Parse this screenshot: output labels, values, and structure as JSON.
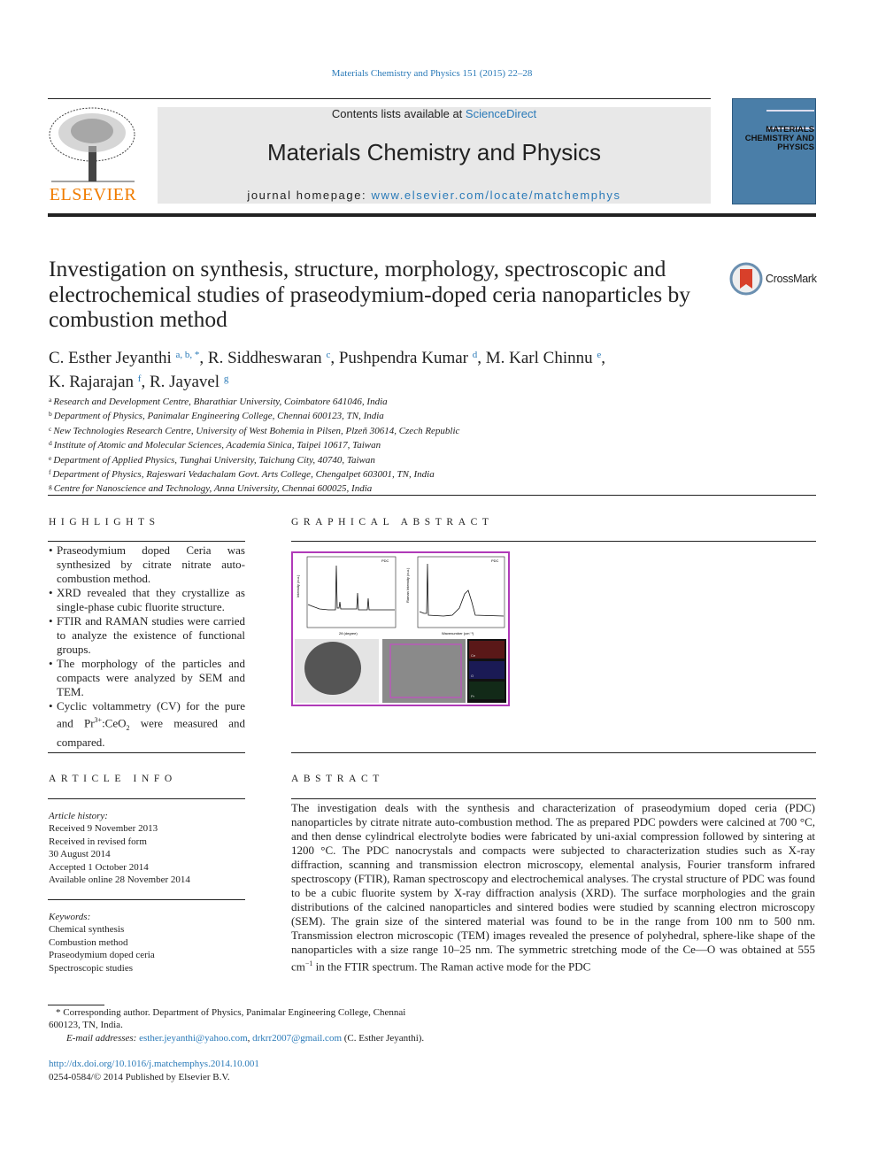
{
  "header": {
    "citation": "Materials Chemistry and Physics 151 (2015) 22–28",
    "contents_prefix": "Contents lists available at ",
    "contents_link": "ScienceDirect",
    "journal_name": "Materials Chemistry and Physics",
    "homepage_prefix": "journal homepage: ",
    "homepage_link": "www.elsevier.com/locate/matchemphys",
    "publisher_logo": "ELSEVIER",
    "cover_title": "MATERIALS CHEMISTRY AND PHYSICS"
  },
  "article": {
    "title": "Investigation on synthesis, structure, morphology, spectroscopic and electrochemical studies of praseodymium-doped ceria nanoparticles by combustion method",
    "crossmark": "CrossMark",
    "authors": [
      {
        "name": "C. Esther Jeyanthi",
        "sup": "a, b, *"
      },
      {
        "name": "R. Siddheswaran",
        "sup": "c"
      },
      {
        "name": "Pushpendra Kumar",
        "sup": "d"
      },
      {
        "name": "M. Karl Chinnu",
        "sup": "e"
      },
      {
        "name": "K. Rajarajan",
        "sup": "f"
      },
      {
        "name": "R. Jayavel",
        "sup": "g"
      }
    ],
    "affiliations": [
      {
        "key": "a",
        "text": "Research and Development Centre, Bharathiar University, Coimbatore 641046, India"
      },
      {
        "key": "b",
        "text": "Department of Physics, Panimalar Engineering College, Chennai 600123, TN, India"
      },
      {
        "key": "c",
        "text": "New Technologies Research Centre, University of West Bohemia in Pilsen, Plzeň 30614, Czech Republic"
      },
      {
        "key": "d",
        "text": "Institute of Atomic and Molecular Sciences, Academia Sinica, Taipei 10617, Taiwan"
      },
      {
        "key": "e",
        "text": "Department of Applied Physics, Tunghai University, Taichung City, 40740, Taiwan"
      },
      {
        "key": "f",
        "text": "Department of Physics, Rajeswari Vedachalam Govt. Arts College, Chengalpet 603001, TN, India"
      },
      {
        "key": "g",
        "text": "Centre for Nanoscience and Technology, Anna University, Chennai 600025, India"
      }
    ]
  },
  "highlights": {
    "heading": "HIGHLIGHTS",
    "items": [
      "Praseodymium doped Ceria was synthesized by citrate nitrate auto-combustion method.",
      "XRD revealed that they crystallize as single-phase cubic fluorite structure.",
      "FTIR and RAMAN studies were carried to analyze the existence of functional groups.",
      "The morphology of the particles and compacts were analyzed by SEM and TEM."
    ],
    "last_item": {
      "pre": "Cyclic voltammetry (CV) for the pure and Pr",
      "sup": "3+",
      "mid": ":CeO",
      "sub": "2",
      "post": " were measured and compared."
    }
  },
  "graphical_abstract": {
    "heading": "GRAPHICAL ABSTRACT",
    "xrd_legend": "PDC",
    "xrd_xlabel": "2θ (degree)",
    "xrd_ylabel": "Intensity (a.u.)",
    "raman_legend": "PDC",
    "raman_xlabel": "Wavenumber (cm⁻¹)",
    "raman_ylabel": "Raman Intensity (a.u.)",
    "eds_labels": [
      "Ce",
      "O",
      "Pr"
    ],
    "accent": "#b03ab8"
  },
  "article_info": {
    "heading": "ARTICLE INFO",
    "history_label": "Article history:",
    "history": [
      "Received 9 November 2013",
      "Received in revised form",
      "30 August 2014",
      "Accepted 1 October 2014",
      "Available online 28 November 2014"
    ],
    "keywords_label": "Keywords:",
    "keywords": [
      "Chemical synthesis",
      "Combustion method",
      "Praseodymium doped ceria",
      "Spectroscopic studies"
    ]
  },
  "abstract": {
    "heading": "ABSTRACT",
    "text": "The investigation deals with the synthesis and characterization of praseodymium doped ceria (PDC) nanoparticles by citrate nitrate auto-combustion method. The as prepared PDC powders were calcined at 700 °C, and then dense cylindrical electrolyte bodies were fabricated by uni-axial compression followed by sintering at 1200 °C. The PDC nanocrystals and compacts were subjected to characterization studies such as X-ray diffraction, scanning and transmission electron microscopy, elemental analysis, Fourier transform infrared spectroscopy (FTIR), Raman spectroscopy and electrochemical analyses. The crystal structure of PDC was found to be a cubic fluorite system by X-ray diffraction analysis (XRD). The surface morphologies and the grain distributions of the calcined nanoparticles and sintered bodies were studied by scanning electron microscopy (SEM). The grain size of the sintered material was found to be in the range from 100 nm to 500 nm. Transmission electron microscopic (TEM) images revealed the presence of polyhedral, sphere-like shape of the nanoparticles with a size range 10–25 nm. The symmetric stretching mode of the Ce—O was obtained at 555 cm",
    "sup": "−1",
    "tail": " in the FTIR spectrum. The Raman active mode for the PDC"
  },
  "footnotes": {
    "corresponding": "* Corresponding author. Department of Physics, Panimalar Engineering College, Chennai 600123, TN, India.",
    "email_label": "E-mail addresses: ",
    "email1": "esther.jeyanthi@yahoo.com",
    "email_sep": ", ",
    "email2": "drkrr2007@gmail.com",
    "email_owner": " (C. Esther Jeyanthi).",
    "doi": "http://dx.doi.org/10.1016/j.matchemphys.2014.10.001",
    "copyright": "0254-0584/© 2014 Published by Elsevier B.V."
  }
}
